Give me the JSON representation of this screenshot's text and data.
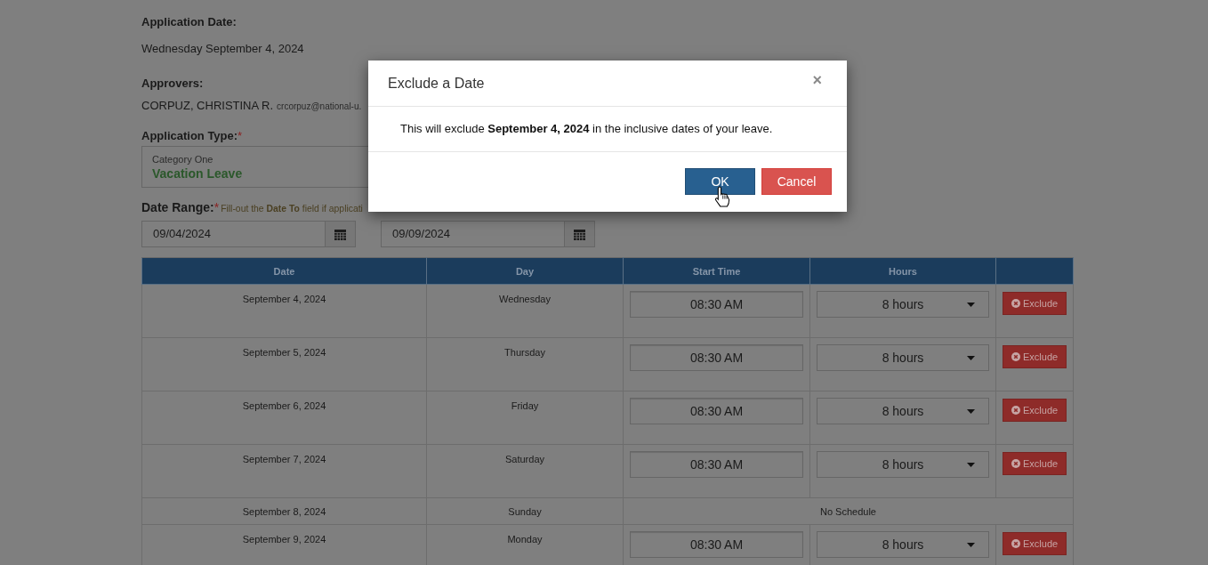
{
  "application_date": {
    "label": "Application Date:",
    "value": "Wednesday September 4, 2024"
  },
  "approvers": {
    "label": "Approvers:",
    "name": "CORPUZ, CHRISTINA R.",
    "email": "crcorpuz@national-u."
  },
  "application_type": {
    "label": "Application Type:",
    "required_mark": "*",
    "category": "Category One",
    "value": "Vacation Leave"
  },
  "date_range": {
    "label": "Date Range:",
    "required_mark": "*",
    "hint": "Fill-out the **Date To** field if applicati",
    "date_from": "09/04/2024",
    "date_to": "09/09/2024"
  },
  "table": {
    "columns": [
      "Date",
      "Day",
      "Start Time",
      "Hours"
    ],
    "rows": [
      {
        "kind": "scheduled",
        "date": "September 4, 2024",
        "day": "Wednesday",
        "start_time": "08:30 AM",
        "hours": "8 hours",
        "action": "Exclude"
      },
      {
        "kind": "scheduled",
        "date": "September 5, 2024",
        "day": "Thursday",
        "start_time": "08:30 AM",
        "hours": "8 hours",
        "action": "Exclude"
      },
      {
        "kind": "scheduled",
        "date": "September 6, 2024",
        "day": "Friday",
        "start_time": "08:30 AM",
        "hours": "8 hours",
        "action": "Exclude"
      },
      {
        "kind": "scheduled",
        "date": "September 7, 2024",
        "day": "Saturday",
        "start_time": "08:30 AM",
        "hours": "8 hours",
        "action": "Exclude"
      },
      {
        "kind": "no_schedule",
        "date": "September 8, 2024",
        "day": "Sunday",
        "note": "No Schedule"
      },
      {
        "kind": "scheduled",
        "date": "September 9, 2024",
        "day": "Monday",
        "start_time": "08:30 AM",
        "hours": "8 hours",
        "action": "Exclude"
      }
    ]
  },
  "modal": {
    "title": "Exclude a Date",
    "close": "×",
    "message": "This will exclude **September 4, 2024** in the inclusive dates of your leave.",
    "buttons": [
      {
        "label": "OK",
        "kind": "primary"
      },
      {
        "label": "Cancel",
        "kind": "danger"
      }
    ]
  }
}
